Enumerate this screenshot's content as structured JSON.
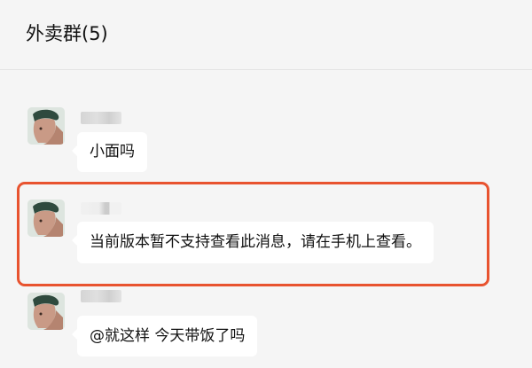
{
  "header": {
    "title": "外卖群(5)"
  },
  "messages": [
    {
      "text": "小面吗"
    },
    {
      "text": "当前版本暂不支持查看此消息，请在手机上查看。"
    },
    {
      "text": "@就这样 今天带饭了吗"
    }
  ],
  "colors": {
    "background": "#f5f5f5",
    "bubble": "#ffffff",
    "highlight_border": "#e8532f"
  }
}
